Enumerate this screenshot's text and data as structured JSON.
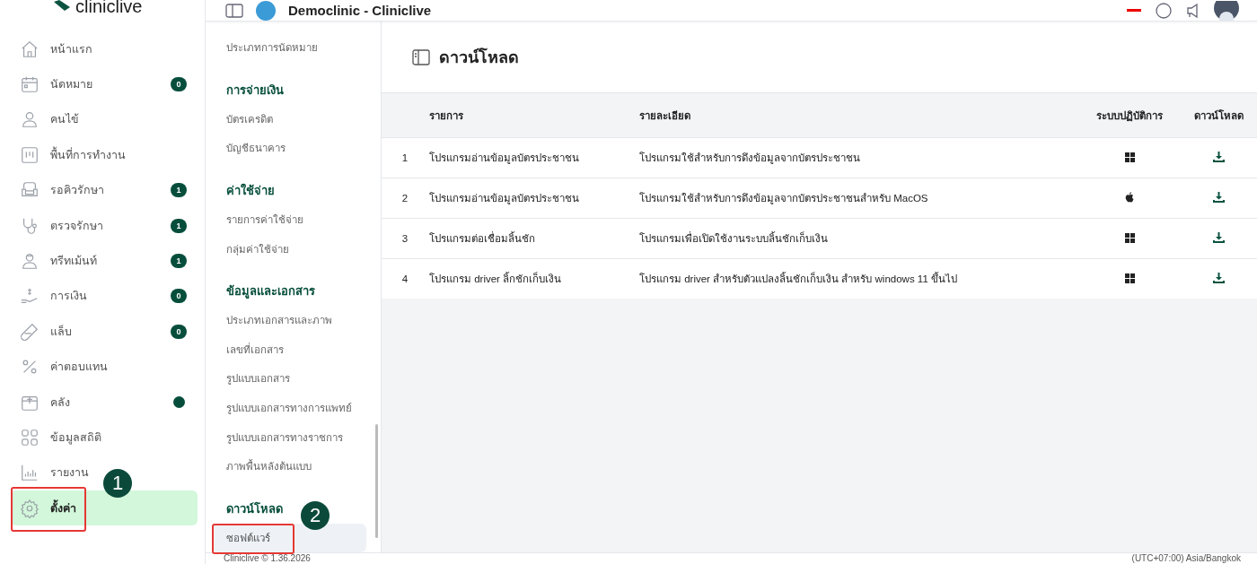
{
  "logo": {
    "text": "cliniclive"
  },
  "header": {
    "title": "Democlinic - Cliniclive"
  },
  "sidebar": {
    "items": [
      {
        "label": "หน้าแรก",
        "selected": false
      },
      {
        "label": "นัดหมาย",
        "badge": "0",
        "selected": false
      },
      {
        "label": "คนไข้",
        "selected": false
      },
      {
        "label": "พื้นที่การทำงาน",
        "selected": false
      },
      {
        "label": "รอคิวรักษา",
        "badge": "1",
        "selected": false
      },
      {
        "label": "ตรวจรักษา",
        "badge": "1",
        "selected": false
      },
      {
        "label": "ทรีทเม้นท์",
        "badge": "1",
        "selected": false
      },
      {
        "label": "การเงิน",
        "badge": "0",
        "selected": false
      },
      {
        "label": "แล็บ",
        "badge": "0",
        "selected": false
      },
      {
        "label": "ค่าตอบแทน",
        "selected": false
      },
      {
        "label": "คลัง",
        "dot": true,
        "selected": false
      },
      {
        "label": "ข้อมูลสถิติ",
        "selected": false
      },
      {
        "label": "รายงาน",
        "selected": false
      },
      {
        "label": "ตั้งค่า",
        "selected": true
      }
    ]
  },
  "submenu": {
    "sections": [
      {
        "items": [
          {
            "label": "ประเภทการนัดหมาย",
            "selected": false
          }
        ]
      },
      {
        "title": "การจ่ายเงิน",
        "items": [
          {
            "label": "บัตรเครดิต",
            "selected": false
          },
          {
            "label": "บัญชีธนาคาร",
            "selected": false
          }
        ]
      },
      {
        "title": "ค่าใช้จ่าย",
        "items": [
          {
            "label": "รายการค่าใช้จ่าย",
            "selected": false
          },
          {
            "label": "กลุ่มค่าใช้จ่าย",
            "selected": false
          }
        ]
      },
      {
        "title": "ข้อมูลและเอกสาร",
        "items": [
          {
            "label": "ประเภทเอกสารและภาพ",
            "selected": false
          },
          {
            "label": "เลขที่เอกสาร",
            "selected": false
          },
          {
            "label": "รูปแบบเอกสาร",
            "selected": false
          },
          {
            "label": "รูปแบบเอกสารทางการแพทย์",
            "selected": false
          },
          {
            "label": "รูปแบบเอกสารทางราชการ",
            "selected": false
          },
          {
            "label": "ภาพพื้นหลังต้นแบบ",
            "selected": false
          }
        ]
      },
      {
        "title": "ดาวน์โหลด",
        "items": [
          {
            "label": "ซอฟต์แวร์",
            "selected": true
          }
        ]
      }
    ]
  },
  "annotations": [
    {
      "number": "1"
    },
    {
      "number": "2"
    }
  ],
  "page": {
    "title": "ดาวน์โหลด"
  },
  "table": {
    "columns": [
      "รายการ",
      "รายละเอียด",
      "ระบบปฏิบัติการ",
      "ดาวน์โหลด"
    ],
    "rows": [
      {
        "index": "1",
        "name": "โปรแกรมอ่านข้อมูลบัตรประชาชน",
        "detail": "โปรแกรมใช้สำหรับการดึงข้อมูลจากบัตรประชาชน",
        "kind": "windows"
      },
      {
        "index": "2",
        "name": "โปรแกรมอ่านข้อมูลบัตรประชาชน",
        "detail": "โปรแกรมใช้สำหรับการดึงข้อมูลจากบัตรประชาชนสำหรับ MacOS",
        "kind": "mac"
      },
      {
        "index": "3",
        "name": "โปรแกรมต่อเชื่อมลิ้นชัก",
        "detail": "โปรแกรมเพื่อเปิดใช้งานระบบลิ้นชักเก็บเงิน",
        "kind": "windows"
      },
      {
        "index": "4",
        "name": "โปรแกรม driver ลิ้กชักเก็บเงิน",
        "detail": "โปรแกรม driver สำหรับตัวแปลงลิ้นชักเก็บเงิน สำหรับ windows 11 ขึ้นไป",
        "kind": "windows"
      }
    ]
  },
  "footer": {
    "left": "Cliniclive © 1.36.2026",
    "right": "(UTC+07:00) Asia/Bangkok"
  }
}
